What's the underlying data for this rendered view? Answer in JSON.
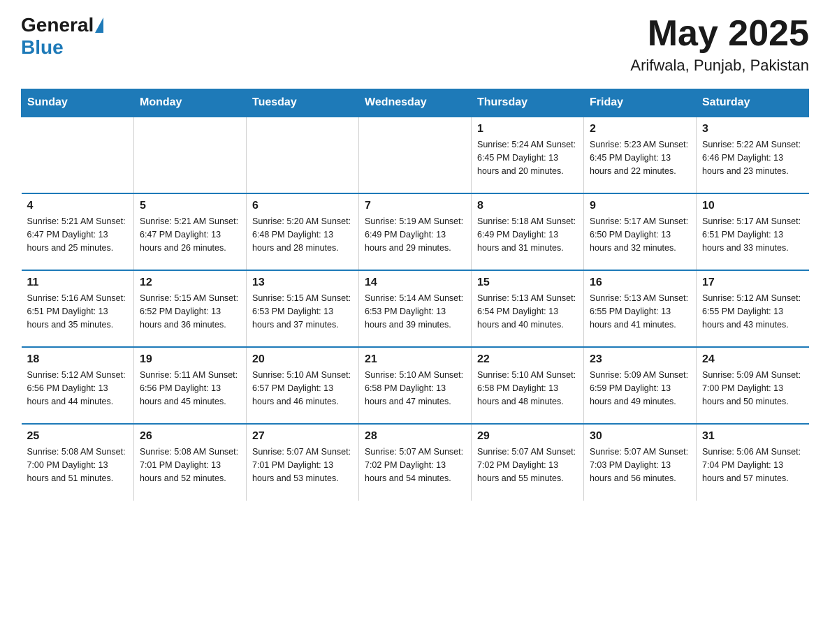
{
  "header": {
    "logo": {
      "general": "General",
      "blue": "Blue"
    },
    "title": "May 2025",
    "location": "Arifwala, Punjab, Pakistan"
  },
  "calendar": {
    "days_of_week": [
      "Sunday",
      "Monday",
      "Tuesday",
      "Wednesday",
      "Thursday",
      "Friday",
      "Saturday"
    ],
    "weeks": [
      [
        {
          "day": "",
          "info": ""
        },
        {
          "day": "",
          "info": ""
        },
        {
          "day": "",
          "info": ""
        },
        {
          "day": "",
          "info": ""
        },
        {
          "day": "1",
          "info": "Sunrise: 5:24 AM\nSunset: 6:45 PM\nDaylight: 13 hours and 20 minutes."
        },
        {
          "day": "2",
          "info": "Sunrise: 5:23 AM\nSunset: 6:45 PM\nDaylight: 13 hours and 22 minutes."
        },
        {
          "day": "3",
          "info": "Sunrise: 5:22 AM\nSunset: 6:46 PM\nDaylight: 13 hours and 23 minutes."
        }
      ],
      [
        {
          "day": "4",
          "info": "Sunrise: 5:21 AM\nSunset: 6:47 PM\nDaylight: 13 hours and 25 minutes."
        },
        {
          "day": "5",
          "info": "Sunrise: 5:21 AM\nSunset: 6:47 PM\nDaylight: 13 hours and 26 minutes."
        },
        {
          "day": "6",
          "info": "Sunrise: 5:20 AM\nSunset: 6:48 PM\nDaylight: 13 hours and 28 minutes."
        },
        {
          "day": "7",
          "info": "Sunrise: 5:19 AM\nSunset: 6:49 PM\nDaylight: 13 hours and 29 minutes."
        },
        {
          "day": "8",
          "info": "Sunrise: 5:18 AM\nSunset: 6:49 PM\nDaylight: 13 hours and 31 minutes."
        },
        {
          "day": "9",
          "info": "Sunrise: 5:17 AM\nSunset: 6:50 PM\nDaylight: 13 hours and 32 minutes."
        },
        {
          "day": "10",
          "info": "Sunrise: 5:17 AM\nSunset: 6:51 PM\nDaylight: 13 hours and 33 minutes."
        }
      ],
      [
        {
          "day": "11",
          "info": "Sunrise: 5:16 AM\nSunset: 6:51 PM\nDaylight: 13 hours and 35 minutes."
        },
        {
          "day": "12",
          "info": "Sunrise: 5:15 AM\nSunset: 6:52 PM\nDaylight: 13 hours and 36 minutes."
        },
        {
          "day": "13",
          "info": "Sunrise: 5:15 AM\nSunset: 6:53 PM\nDaylight: 13 hours and 37 minutes."
        },
        {
          "day": "14",
          "info": "Sunrise: 5:14 AM\nSunset: 6:53 PM\nDaylight: 13 hours and 39 minutes."
        },
        {
          "day": "15",
          "info": "Sunrise: 5:13 AM\nSunset: 6:54 PM\nDaylight: 13 hours and 40 minutes."
        },
        {
          "day": "16",
          "info": "Sunrise: 5:13 AM\nSunset: 6:55 PM\nDaylight: 13 hours and 41 minutes."
        },
        {
          "day": "17",
          "info": "Sunrise: 5:12 AM\nSunset: 6:55 PM\nDaylight: 13 hours and 43 minutes."
        }
      ],
      [
        {
          "day": "18",
          "info": "Sunrise: 5:12 AM\nSunset: 6:56 PM\nDaylight: 13 hours and 44 minutes."
        },
        {
          "day": "19",
          "info": "Sunrise: 5:11 AM\nSunset: 6:56 PM\nDaylight: 13 hours and 45 minutes."
        },
        {
          "day": "20",
          "info": "Sunrise: 5:10 AM\nSunset: 6:57 PM\nDaylight: 13 hours and 46 minutes."
        },
        {
          "day": "21",
          "info": "Sunrise: 5:10 AM\nSunset: 6:58 PM\nDaylight: 13 hours and 47 minutes."
        },
        {
          "day": "22",
          "info": "Sunrise: 5:10 AM\nSunset: 6:58 PM\nDaylight: 13 hours and 48 minutes."
        },
        {
          "day": "23",
          "info": "Sunrise: 5:09 AM\nSunset: 6:59 PM\nDaylight: 13 hours and 49 minutes."
        },
        {
          "day": "24",
          "info": "Sunrise: 5:09 AM\nSunset: 7:00 PM\nDaylight: 13 hours and 50 minutes."
        }
      ],
      [
        {
          "day": "25",
          "info": "Sunrise: 5:08 AM\nSunset: 7:00 PM\nDaylight: 13 hours and 51 minutes."
        },
        {
          "day": "26",
          "info": "Sunrise: 5:08 AM\nSunset: 7:01 PM\nDaylight: 13 hours and 52 minutes."
        },
        {
          "day": "27",
          "info": "Sunrise: 5:07 AM\nSunset: 7:01 PM\nDaylight: 13 hours and 53 minutes."
        },
        {
          "day": "28",
          "info": "Sunrise: 5:07 AM\nSunset: 7:02 PM\nDaylight: 13 hours and 54 minutes."
        },
        {
          "day": "29",
          "info": "Sunrise: 5:07 AM\nSunset: 7:02 PM\nDaylight: 13 hours and 55 minutes."
        },
        {
          "day": "30",
          "info": "Sunrise: 5:07 AM\nSunset: 7:03 PM\nDaylight: 13 hours and 56 minutes."
        },
        {
          "day": "31",
          "info": "Sunrise: 5:06 AM\nSunset: 7:04 PM\nDaylight: 13 hours and 57 minutes."
        }
      ]
    ]
  }
}
